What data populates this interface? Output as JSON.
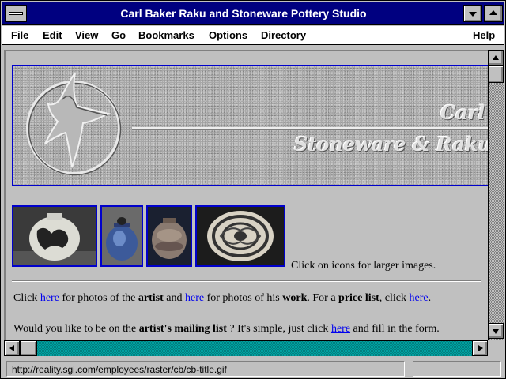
{
  "window": {
    "title": "Carl Baker Raku and Stoneware Pottery Studio"
  },
  "menu": {
    "file": "File",
    "edit": "Edit",
    "view": "View",
    "go": "Go",
    "bookmarks": "Bookmarks",
    "options": "Options",
    "directory": "Directory",
    "help": "Help"
  },
  "banner": {
    "line1": "Carl B",
    "line2": "Stoneware & Raku Po"
  },
  "thumbnails": {
    "caption": "Click on icons for larger images."
  },
  "paragraph1": {
    "t1": "Click ",
    "link1": "here",
    "t2": " for photos of the ",
    "b1": "artist",
    "t3": " and ",
    "link2": "here",
    "t4": " for photos of his ",
    "b2": "work",
    "t5": ". For a ",
    "b3": "price list",
    "t6": ", click ",
    "link3": "here",
    "t7": "."
  },
  "paragraph2": {
    "t1": "Would you like to be on the ",
    "b1": "artist's mailing list",
    "t2": " ? It's simple, just click ",
    "link1": "here",
    "t3": " and fill in the form."
  },
  "status": {
    "url": "http://reality.sgi.com/employees/raster/cb/cb-title.gif"
  },
  "colors": {
    "title_bar": "#000080",
    "link": "#0000ee",
    "image_border": "#0000cc",
    "desktop": "#008080"
  }
}
